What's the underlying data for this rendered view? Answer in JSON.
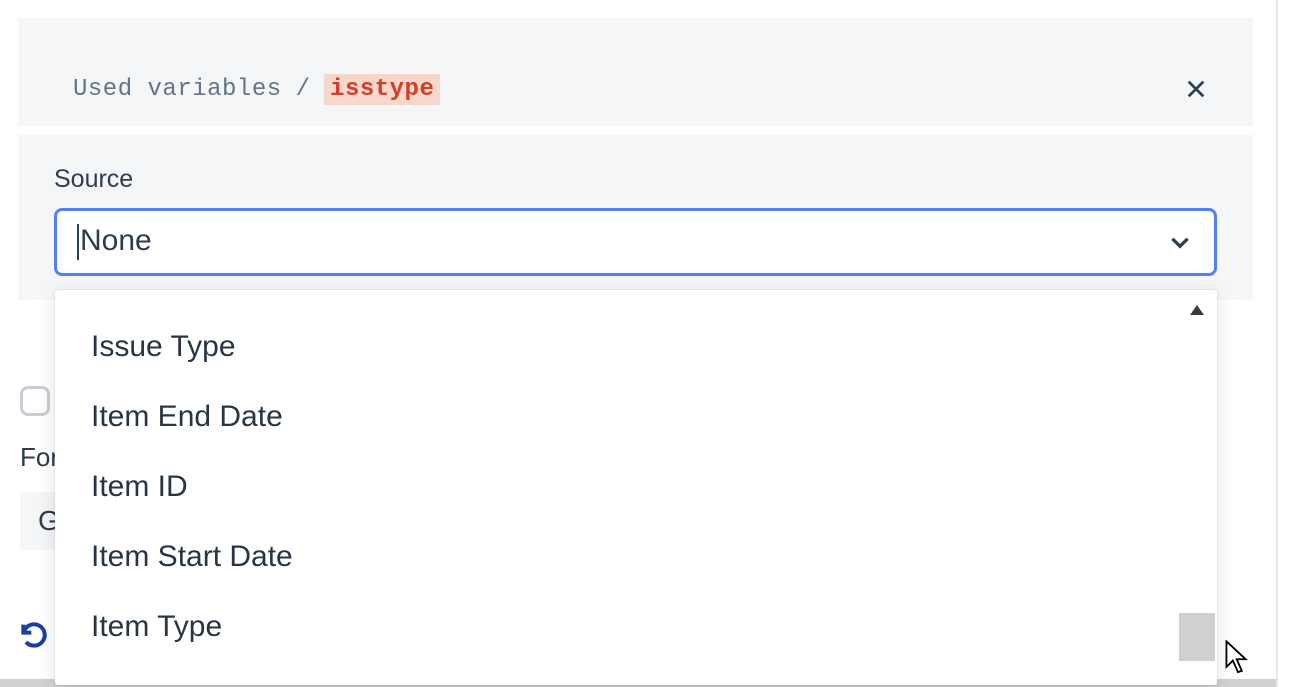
{
  "breadcrumb": {
    "label": "Used variables",
    "separator": "/",
    "variable": "isstype"
  },
  "source": {
    "label": "Source",
    "selected": "None",
    "options": [
      "Issue Type",
      "Item End Date",
      "Item ID",
      "Item Start Date",
      "Item Type"
    ]
  },
  "partials": {
    "for_label": "For",
    "g_char": "G"
  }
}
